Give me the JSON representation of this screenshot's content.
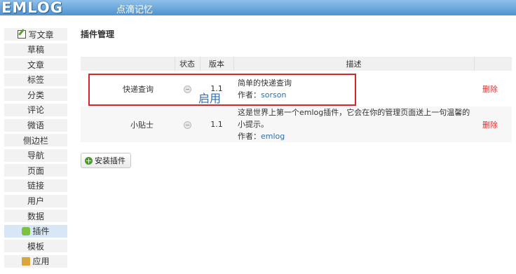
{
  "header": {
    "logo_text": "EMLOG",
    "site_name": "点滴记忆"
  },
  "sidebar": {
    "items": [
      {
        "label": "写文章",
        "icon": "pencil-icon",
        "active": false
      },
      {
        "label": "草稿",
        "icon": "",
        "active": false
      },
      {
        "label": "文章",
        "icon": "",
        "active": false
      },
      {
        "label": "标签",
        "icon": "",
        "active": false
      },
      {
        "label": "分类",
        "icon": "",
        "active": false
      },
      {
        "label": "评论",
        "icon": "",
        "active": false
      },
      {
        "label": "微语",
        "icon": "",
        "active": false
      },
      {
        "label": "侧边栏",
        "icon": "",
        "active": false
      },
      {
        "label": "导航",
        "icon": "",
        "active": false
      },
      {
        "label": "页面",
        "icon": "",
        "active": false
      },
      {
        "label": "链接",
        "icon": "",
        "active": false
      },
      {
        "label": "用户",
        "icon": "",
        "active": false
      },
      {
        "label": "数据",
        "icon": "",
        "active": false
      },
      {
        "label": "插件",
        "icon": "plugin-icon",
        "active": true
      },
      {
        "label": "模板",
        "icon": "",
        "active": false
      },
      {
        "label": "应用",
        "icon": "app-icon",
        "active": false
      }
    ]
  },
  "main": {
    "title": "插件管理",
    "table": {
      "headers": {
        "status": "状态",
        "version": "版本",
        "description": "描述"
      },
      "rows": [
        {
          "name": "快递查询",
          "version": "1.1",
          "description": "简单的快递查询",
          "author_label": "作者：",
          "author": "sorson",
          "delete": "删除"
        },
        {
          "name": "小贴士",
          "version": "1.1",
          "description": "这是世界上第一个emlog插件，它会在你的管理页面送上一句温馨的小提示。",
          "author_label": "作者：",
          "author": "emlog",
          "delete": "删除"
        }
      ]
    },
    "annotation": "启用",
    "install_button": "安装插件"
  },
  "colors": {
    "header_bar": "#4f93cf",
    "annotation_box": "#d6252c",
    "annotation_text": "#2f6fb7",
    "delete_link": "#dd3333"
  }
}
